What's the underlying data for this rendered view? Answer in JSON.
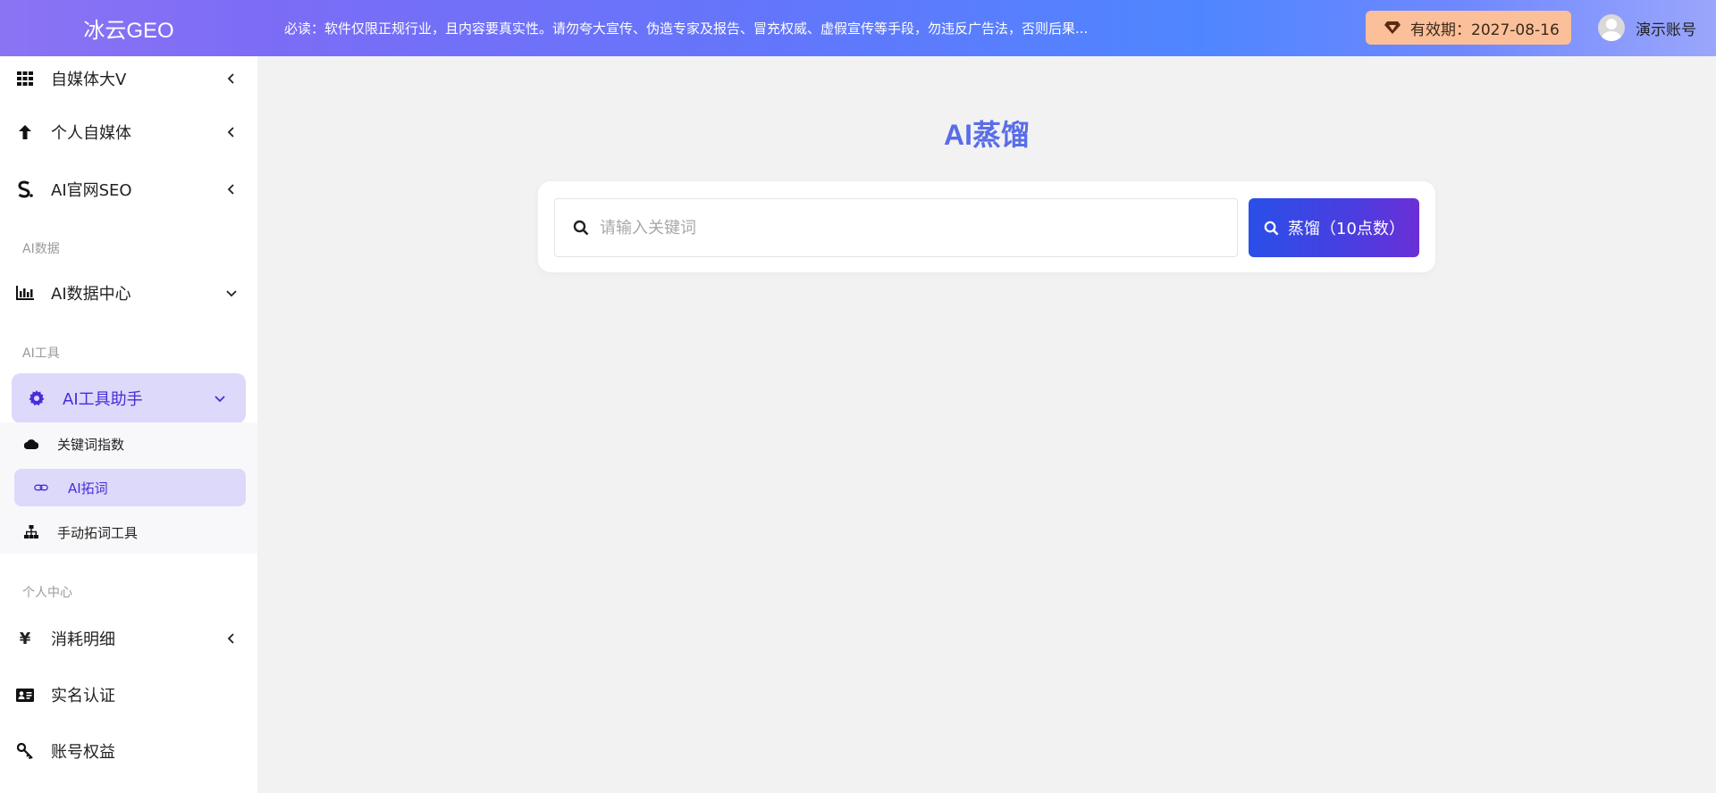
{
  "app": {
    "title": "冰云GEO"
  },
  "header": {
    "notice": "必读：软件仅限正规行业，且内容要真实性。请勿夸大宣传、伪造专家及报告、冒充权威、虚假宣传等手段，勿违反广告法，否则后果...",
    "expiry_label": "有效期：2027-08-16",
    "user_name": "演示账号"
  },
  "sidebar": {
    "items_top": [
      {
        "label": "自媒体大V",
        "icon": "grid-icon"
      },
      {
        "label": "个人自媒体",
        "icon": "arrow-up-icon"
      },
      {
        "label": "AI官网SEO",
        "icon": "s-logo-icon"
      }
    ],
    "section_data": "AI数据",
    "data_center": {
      "label": "AI数据中心",
      "icon": "bar-chart-icon"
    },
    "section_tools": "AI工具",
    "tools_helper": {
      "label": "AI工具助手",
      "icon": "gear-icon"
    },
    "sub_items": [
      {
        "label": "关键词指数",
        "icon": "cloud-icon"
      },
      {
        "label": "AI拓词",
        "icon": "link-icon"
      },
      {
        "label": "手动拓词工具",
        "icon": "sitemap-icon"
      }
    ],
    "section_personal": "个人中心",
    "items_bottom": [
      {
        "label": "消耗明细",
        "icon": "yen-icon"
      },
      {
        "label": "实名认证",
        "icon": "id-card-icon"
      },
      {
        "label": "账号权益",
        "icon": "key-icon"
      }
    ]
  },
  "main": {
    "title": "AI蒸馏",
    "search_placeholder": "请输入关键词",
    "search_value": "",
    "button_label": "蒸馏（10点数）"
  },
  "colors": {
    "accent": "#4a2bd8",
    "title": "#5a6de8",
    "active_bg": "#dcd9fb",
    "expiry_bg": "#fbbf9a"
  }
}
